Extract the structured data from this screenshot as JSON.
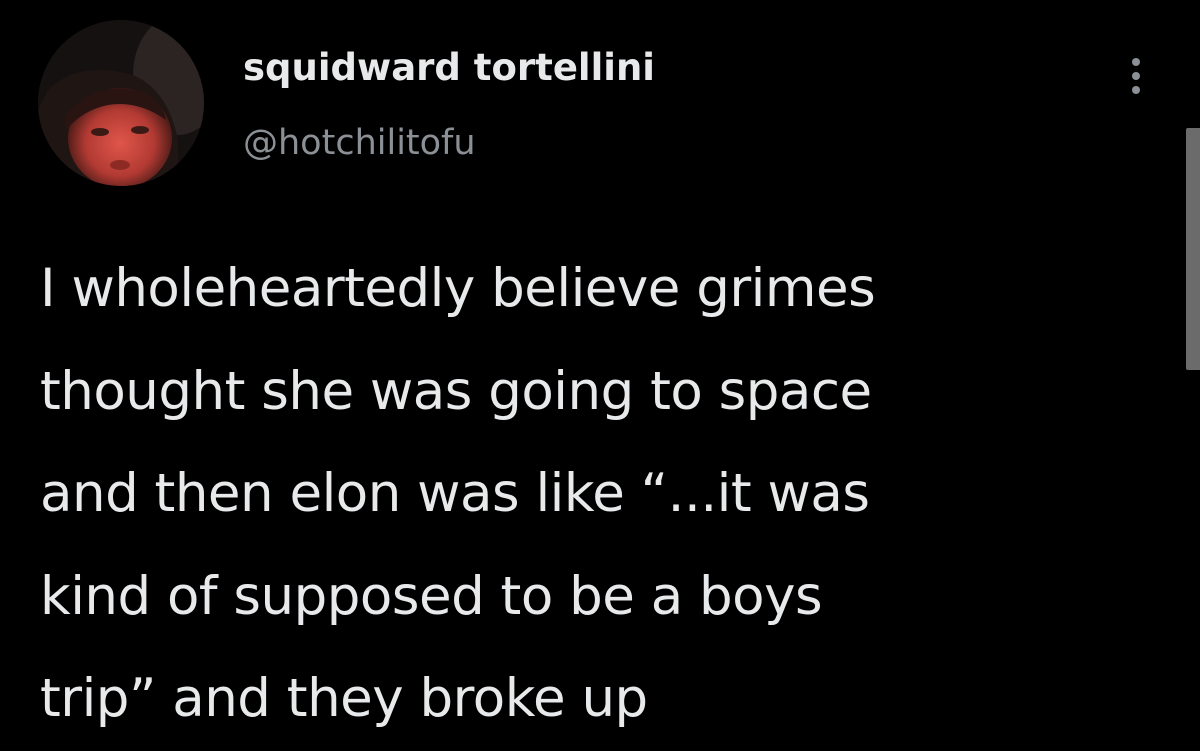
{
  "tweet": {
    "author": {
      "display_name": "squidward tortellini",
      "handle": "@hotchilitofu",
      "avatar_icon": "profile-photo"
    },
    "more_icon": "more-vertical-icon",
    "text": "I wholeheartedly believe grimes\nthought she was going to space\nand then elon was like “...it was\nkind of supposed to be a boys\ntrip” and they broke up"
  },
  "colors": {
    "background": "#000000",
    "primary_text": "#e7e9ea",
    "secondary_text": "#8b9096",
    "scrollbar": "#6b6b6b"
  }
}
